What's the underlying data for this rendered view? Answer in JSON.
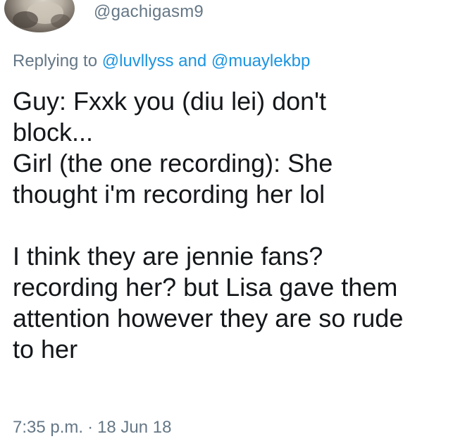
{
  "tweet": {
    "handle": "@gachigasm9",
    "replying_prefix": "Replying to",
    "replying_mentions": [
      "@luvllyss",
      "@muaylekbp"
    ],
    "replying_joiner": "and",
    "body_paragraphs": [
      "Guy: Fxxk you (diu lei) don't\nblock...\nGirl (the one recording): She\nthought i'm recording her lol",
      "I think they are jennie fans?\nrecording her? but Lisa gave them\nattention however they are so rude\nto her"
    ],
    "time": "7:35 p.m.",
    "separator": "·",
    "date": "18 Jun 18"
  },
  "colors": {
    "text": "#14171a",
    "muted": "#657786",
    "mention": "#1b95e0"
  }
}
